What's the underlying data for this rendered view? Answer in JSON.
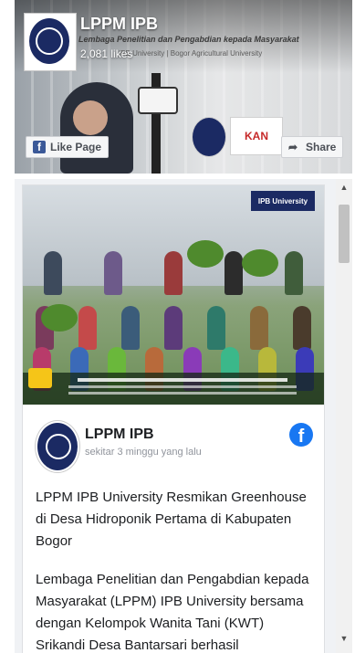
{
  "header": {
    "page_name": "LPPM IPB",
    "likes": "2,081 likes",
    "banner_subtitle": "Lembaga Penelitian dan Pengabdian kepada Masyarakat",
    "banner_sub2": "IPB University | Bogor Agricultural University",
    "like_button": "Like Page",
    "share_button": "Share",
    "kan_badge": "KAN"
  },
  "post": {
    "author": "LPPM IPB",
    "time": "sekitar 3 minggu yang lalu",
    "photo_tag": "IPB University",
    "title": "LPPM IPB University Resmikan Greenhouse di Desa Hidroponik Pertama di Kabupaten Bogor",
    "body": "Lembaga Penelitian dan Pengabdian kepada Masyarakat (LPPM) IPB University bersama dengan Kelompok Wanita Tani (KWT) Srikandi Desa Bantarsari berhasil"
  },
  "colors": {
    "facebook_blue": "#1877f2",
    "ipb_navy": "#1b2a63"
  }
}
